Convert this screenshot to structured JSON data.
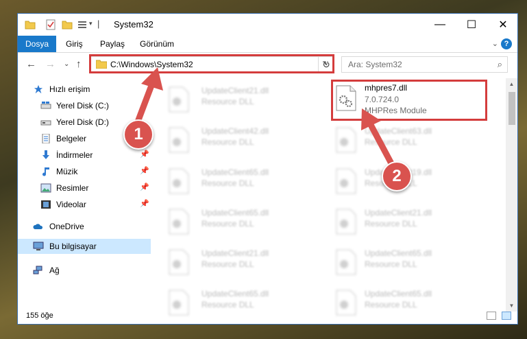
{
  "window": {
    "title": "System32",
    "controls": {
      "minimize": "—",
      "maximize": "☐",
      "close": "✕"
    }
  },
  "ribbon": {
    "tabs": [
      "Dosya",
      "Giriş",
      "Paylaş",
      "Görünüm"
    ],
    "help": "?"
  },
  "address": {
    "path": "C:\\Windows\\System32",
    "search_placeholder": "Ara: System32"
  },
  "nav": {
    "items": [
      {
        "label": "Hızlı erişim",
        "icon": "star-icon",
        "pinned": false
      },
      {
        "label": "Yerel Disk (C:)",
        "icon": "drive-c-icon",
        "pinned": false
      },
      {
        "label": "Yerel Disk (D:)",
        "icon": "drive-icon",
        "pinned": false
      },
      {
        "label": "Belgeler",
        "icon": "documents-icon",
        "pinned": true
      },
      {
        "label": "İndirmeler",
        "icon": "downloads-icon",
        "pinned": true
      },
      {
        "label": "Müzik",
        "icon": "music-icon",
        "pinned": true
      },
      {
        "label": "Resimler",
        "icon": "pictures-icon",
        "pinned": true
      },
      {
        "label": "Videolar",
        "icon": "videos-icon",
        "pinned": true
      },
      {
        "label": "OneDrive",
        "icon": "onedrive-icon",
        "pinned": false
      },
      {
        "label": "Bu bilgisayar",
        "icon": "computer-icon",
        "pinned": false,
        "selected": true
      },
      {
        "label": "Ağ",
        "icon": "network-icon",
        "pinned": false
      }
    ]
  },
  "files": {
    "highlighted": {
      "name": "mhpres7.dll",
      "version": "7.0.724.0",
      "description": "MHPRes Module"
    },
    "left_column": [
      {
        "name": "UpdateClient21.dll",
        "desc": "Resource DLL"
      },
      {
        "name": "UpdateClient42.dll",
        "desc": "Resource DLL"
      },
      {
        "name": "UpdateClient65.dll",
        "desc": "Resource DLL"
      },
      {
        "name": "UpdateClient65.dll",
        "desc": "Resource DLL"
      },
      {
        "name": "UpdateClient21.dll",
        "desc": "Resource DLL"
      },
      {
        "name": "UpdateClient65.dll",
        "desc": "Resource DLL"
      }
    ],
    "right_column": [
      {
        "name": "UpdateClient63.dll",
        "desc": "Resource DLL"
      },
      {
        "name": "UpdateClient19.dll",
        "desc": "Resource DLL"
      },
      {
        "name": "UpdateClient21.dll",
        "desc": "Resource DLL"
      },
      {
        "name": "UpdateClient65.dll",
        "desc": "Resource DLL"
      },
      {
        "name": "UpdateClient65.dll",
        "desc": "Resource DLL"
      }
    ]
  },
  "status": {
    "count": "155 öğe"
  },
  "annotations": {
    "step1": "1",
    "step2": "2"
  },
  "colors": {
    "accent": "#1979ca",
    "highlight": "#d43c3c",
    "selected": "#cce8ff"
  }
}
